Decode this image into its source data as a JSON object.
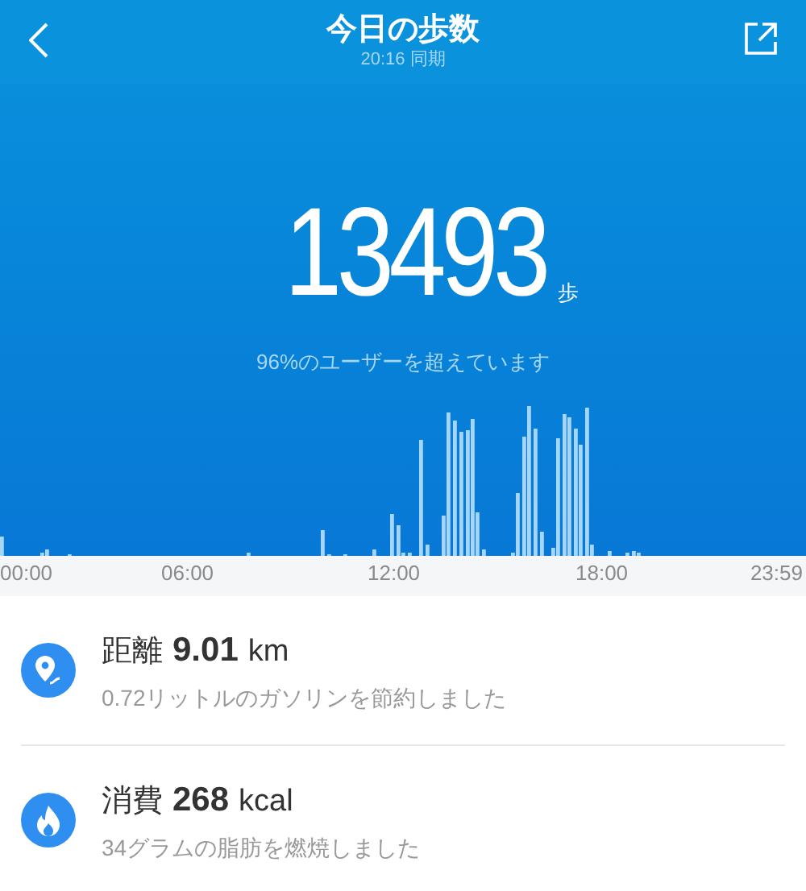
{
  "header": {
    "title": "今日の歩数",
    "subtitle": "20:16 同期"
  },
  "steps": {
    "count": "13493",
    "unit": "歩",
    "comparison": "96%のユーザーを超えています"
  },
  "time_axis": [
    "00:00",
    "06:00",
    "12:00",
    "18:00",
    "23:59"
  ],
  "metrics": [
    {
      "kind": "distance",
      "label": "距離",
      "value": "9.01",
      "unit": "km",
      "note": "0.72リットルのガソリンを節約しました"
    },
    {
      "kind": "calories",
      "label": "消費",
      "value": "268",
      "unit": "kcal",
      "note": "34グラムの脂肪を燃焼しました"
    }
  ]
}
